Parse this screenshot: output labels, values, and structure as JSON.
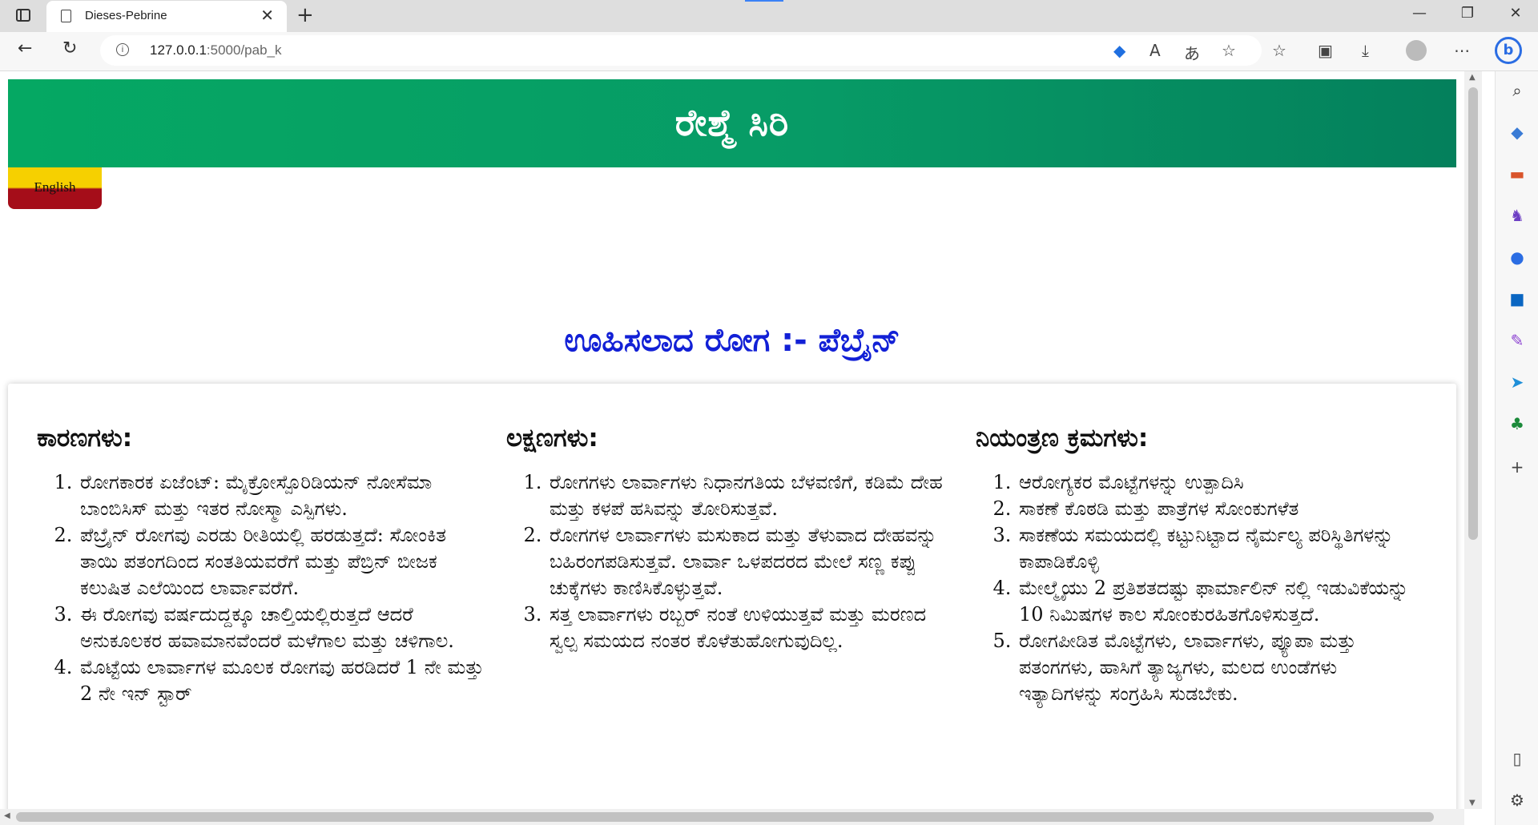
{
  "browser": {
    "tab_title": "Dieses-Pebrine",
    "url_host": "127.0.0.1",
    "url_rest": ":5000/pab_k",
    "icons": [
      "tab-actions-icon",
      "page-icon",
      "close-icon",
      "new-tab-icon",
      "minimize-icon",
      "maximize-icon",
      "window-close-icon",
      "back-icon",
      "refresh-icon",
      "info-icon",
      "shopping-tag-icon",
      "read-aloud-icon",
      "translate-icon",
      "add-favorite-icon",
      "favorites-icon",
      "collections-icon",
      "downloads-icon",
      "profile-icon",
      "more-icon",
      "bing-icon"
    ]
  },
  "sidebar_icons": [
    "search-icon",
    "shopping-icon",
    "tools-icon",
    "games-icon",
    "microsoft-365-icon",
    "outlook-icon",
    "designer-icon",
    "send-icon",
    "tree-icon",
    "add-icon",
    "split-screen-icon",
    "settings-icon"
  ],
  "page": {
    "site_title": "ರೇಶ್ಮೆ ಸಿರಿ",
    "language_button": "English",
    "predicted_disease": "ಊಹಿಸಲಾದ ರೋಗ :- ಪೆಬ್ರೈನ್",
    "columns": [
      {
        "heading": "ಕಾರಣಗಳು:",
        "items": [
          "ರೋಗಕಾರಕ ಏಜೆಂಟ್: ಮೈಕ್ರೋಸ್ಪೊರಿಡಿಯನ್ ನೋಸೆಮಾ ಬಾಂಬಿಸಿಸ್ ಮತ್ತು ಇತರ ನೋಸ್ಮಾ ಎಸ್ಪಿಗಳು.",
          "ಪೆಬ್ರೈನ್ ರೋಗವು ಎರಡು ರೀತಿಯಲ್ಲಿ ಹರಡುತ್ತದೆ: ಸೋಂಕಿತ ತಾಯಿ ಪತಂಗದಿಂದ ಸಂತತಿಯವರೆಗೆ ಮತ್ತು ಪೆಬ್ರಿನ್ ಬೀಜಕ ಕಲುಷಿತ ಎಲೆಯಿಂದ ಲಾರ್ವಾವರೆಗೆ.",
          "ಈ ರೋಗವು ವರ್ಷದುದ್ದಕ್ಕೂ ಚಾಲ್ತಿಯಲ್ಲಿರುತ್ತದೆ ಆದರೆ ಅನುಕೂಲಕರ ಹವಾಮಾನವೆಂದರೆ ಮಳೆಗಾಲ ಮತ್ತು ಚಳಿಗಾಲ.",
          "ಮೊಟ್ಟೆಯ ಲಾರ್ವಾಗಳ ಮೂಲಕ ರೋಗವು ಹರಡಿದರೆ 1 ನೇ ಮತ್ತು 2 ನೇ ಇನ್ ಸ್ಟಾರ್"
        ]
      },
      {
        "heading": "ಲಕ್ಷಣಗಳು:",
        "items": [
          "ರೋಗಗಳು ಲಾರ್ವಾಗಳು ನಿಧಾನಗತಿಯ ಬೆಳವಣಿಗೆ, ಕಡಿಮೆ ದೇಹ ಮತ್ತು ಕಳಪೆ ಹಸಿವನ್ನು ತೋರಿಸುತ್ತವೆ.",
          "ರೋಗಗಳ ಲಾರ್ವಾಗಳು ಮಸುಕಾದ ಮತ್ತು ತೆಳುವಾದ ದೇಹವನ್ನು ಬಹಿರಂಗಪಡಿಸುತ್ತವೆ. ಲಾರ್ವಾ ಒಳಪದರದ ಮೇಲೆ ಸಣ್ಣ ಕಪ್ಪು ಚುಕ್ಕೆಗಳು ಕಾಣಿಸಿಕೊಳ್ಳುತ್ತವೆ.",
          "ಸತ್ತ ಲಾರ್ವಾಗಳು ರಬ್ಬರ್ ನಂತೆ ಉಳಿಯುತ್ತವೆ ಮತ್ತು ಮರಣದ ಸ್ವಲ್ಪ ಸಮಯದ ನಂತರ ಕೊಳೆತುಹೋಗುವುದಿಲ್ಲ."
        ]
      },
      {
        "heading": "ನಿಯಂತ್ರಣ ಕ್ರಮಗಳು:",
        "items": [
          "ಆರೋಗ್ಯಕರ ಮೊಟ್ಟೆಗಳನ್ನು ಉತ್ಪಾದಿಸಿ",
          "ಸಾಕಣೆ ಕೊಠಡಿ ಮತ್ತು ಪಾತ್ರೆಗಳ ಸೋಂಕುಗಳೆತ",
          "ಸಾಕಣೆಯ ಸಮಯದಲ್ಲಿ ಕಟ್ಟುನಿಟ್ಟಾದ ನೈರ್ಮಲ್ಯ ಪರಿಸ್ಥಿತಿಗಳನ್ನು ಕಾಪಾಡಿಕೊಳ್ಳಿ",
          "ಮೇಲ್ಮೈಯು 2 ಪ್ರತಿಶತದಷ್ಟು ಫಾರ್ಮಾಲಿನ್ ನಲ್ಲಿ ಇಡುವಿಕೆಯನ್ನು 10 ನಿಮಿಷಗಳ ಕಾಲ ಸೋಂಕುರಹಿತಗೊಳಿಸುತ್ತದೆ.",
          "ರೋಗಪೀಡಿತ ಮೊಟ್ಟೆಗಳು, ಲಾರ್ವಾಗಳು, ಪ್ಯೂಪಾ ಮತ್ತು ಪತಂಗಗಳು, ಹಾಸಿಗೆ ತ್ಯಾಜ್ಯಗಳು, ಮಲದ ಉಂಡೆಗಳು ಇತ್ಯಾದಿಗಳನ್ನು ಸಂಗ್ರಹಿಸಿ ಸುಡಬೇಕು."
        ]
      }
    ]
  },
  "colors": {
    "banner_start": "#05a863",
    "banner_end": "#04805c",
    "predicted_text": "#1220d6",
    "lang_top": "#f6d000",
    "lang_bottom": "#a50d19"
  }
}
